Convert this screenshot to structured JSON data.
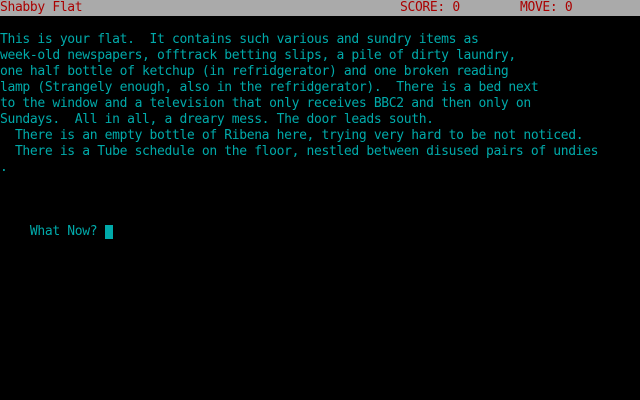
{
  "status": {
    "location": "Shabby Flat",
    "score": "SCORE: 0",
    "moves": "MOVE: 0"
  },
  "output": {
    "lines": [
      "This is your flat.  It contains such various and sundry items as",
      "week-old newspapers, offtrack betting slips, a pile of dirty laundry,",
      "one half bottle of ketchup (in refridgerator) and one broken reading",
      "lamp (Strangely enough, also in the refridgerator).  There is a bed next",
      "to the window and a television that only receives BBC2 and then only on",
      "Sundays.  All in all, a dreary mess. The door leads south.",
      "  There is an empty bottle of Ribena here, trying very hard to be not noticed.",
      "  There is a Tube schedule on the floor, nestled between disused pairs of undies",
      "."
    ]
  },
  "prompt": {
    "label": "What Now? "
  },
  "colors": {
    "status_bg": "#aaaaaa",
    "status_fg": "#aa0000",
    "text": "#00aaaa",
    "background": "#000000"
  }
}
